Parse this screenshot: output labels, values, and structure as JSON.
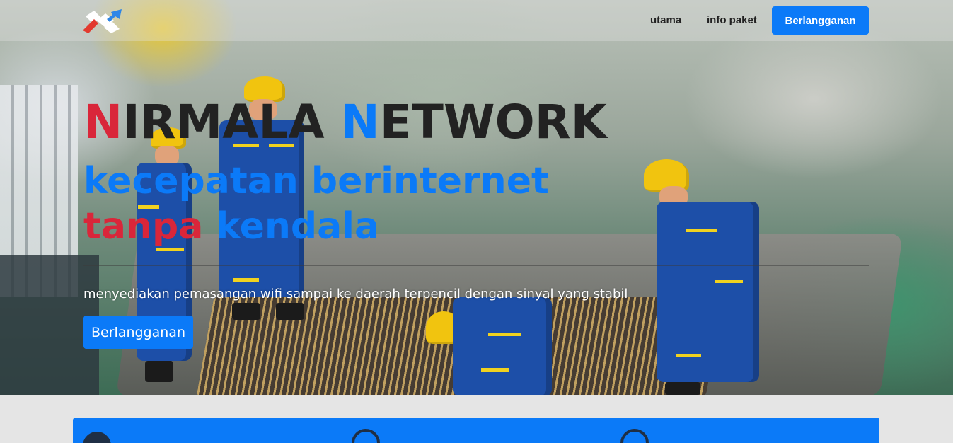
{
  "navbar": {
    "logo_icon": "brand-logo",
    "links": [
      {
        "label": "utama"
      },
      {
        "label": "info paket"
      }
    ],
    "cta_label": "Berlangganan"
  },
  "hero": {
    "title": {
      "n1": "N",
      "rest1": "IRMALA ",
      "n2": "N",
      "rest2": "ETWORK"
    },
    "tagline_line1": "kecepatan berinternet",
    "tagline_line2_red": "tanpa",
    "tagline_line2_blue": " kendala",
    "description": "menyediakan pemasangan wifi sampai ke daerah terpencil dengan sinyal yang stabil",
    "cta_label": "Berlangganan"
  },
  "features": {
    "icons": [
      "cloud-icon",
      "github-icon",
      "speedometer-icon"
    ]
  },
  "colors": {
    "primary": "#0b7af8",
    "accent_red": "#d9263a",
    "text_dark": "#222222"
  }
}
